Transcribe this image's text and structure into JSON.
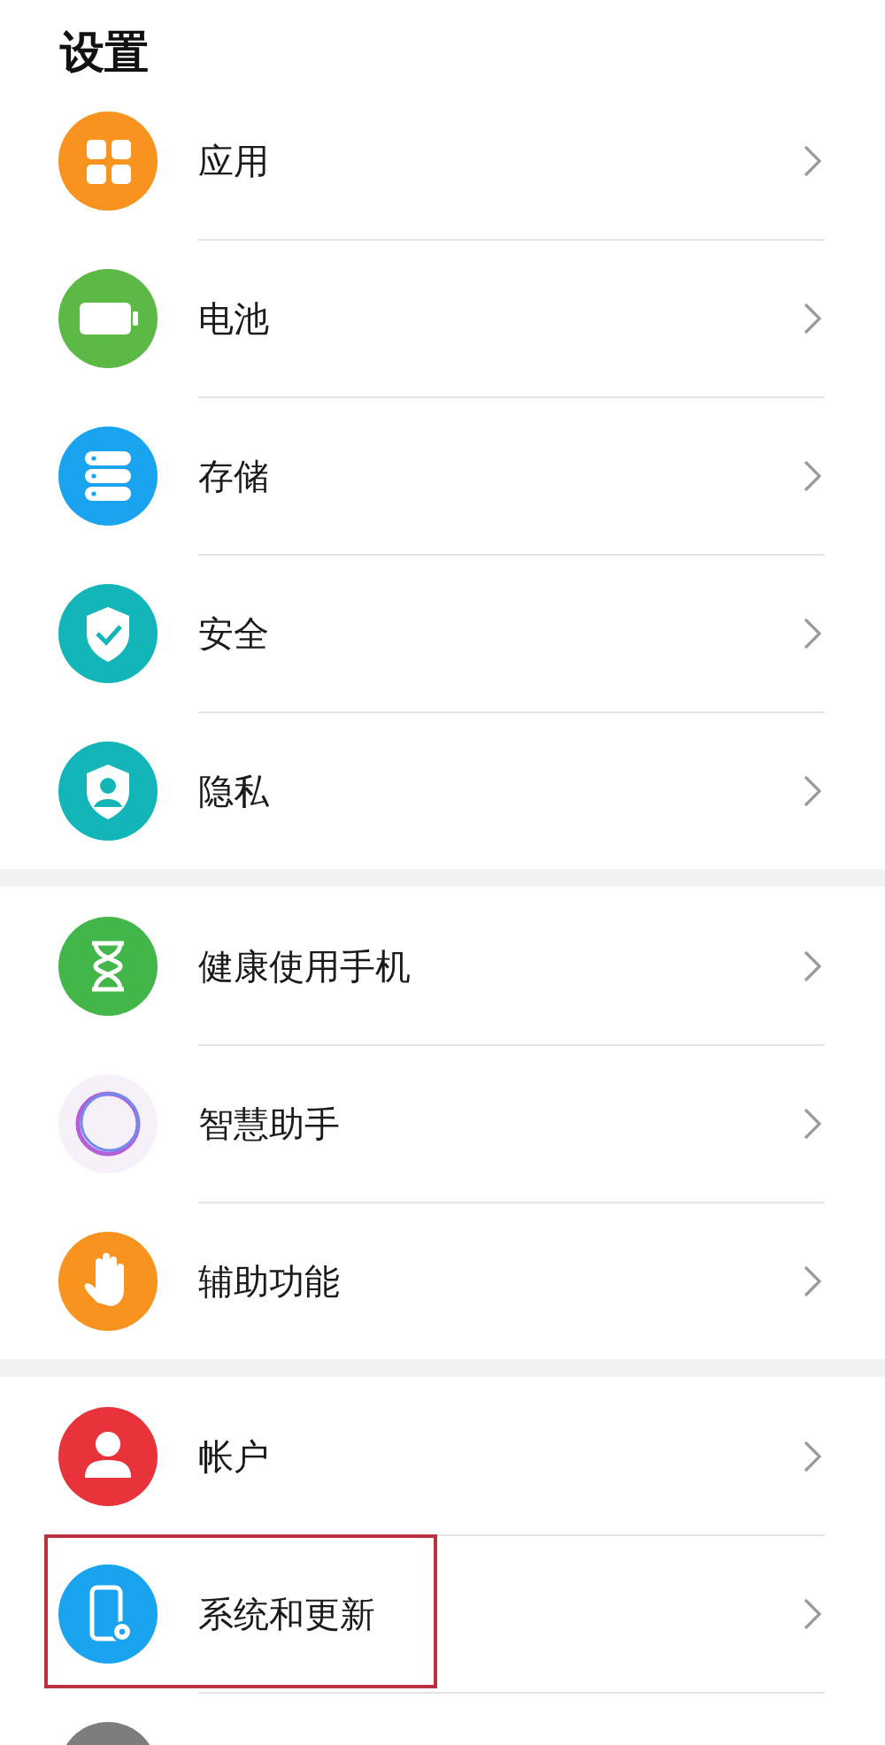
{
  "title": "设置",
  "groups": [
    {
      "items": [
        {
          "label": "应用",
          "highlighted": false
        },
        {
          "label": "电池",
          "highlighted": false
        },
        {
          "label": "存储",
          "highlighted": false
        },
        {
          "label": "安全",
          "highlighted": false
        },
        {
          "label": "隐私",
          "highlighted": false
        }
      ]
    },
    {
      "items": [
        {
          "label": "健康使用手机",
          "highlighted": false
        },
        {
          "label": "智慧助手",
          "highlighted": false
        },
        {
          "label": "辅助功能",
          "highlighted": false
        }
      ]
    },
    {
      "items": [
        {
          "label": "帐户",
          "highlighted": false
        },
        {
          "label": "系统和更新",
          "highlighted": true
        },
        {
          "highlighted": false
        }
      ]
    }
  ]
}
